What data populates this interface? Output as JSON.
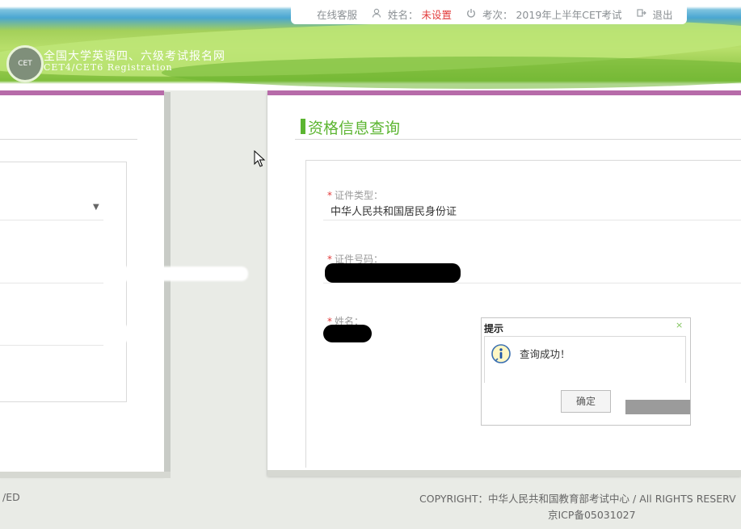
{
  "header": {
    "site_title_cn": "全国大学英语四、六级考试报名网",
    "site_title_en": "CET4/CET6  Registration",
    "logo_text": "CET",
    "nav": {
      "online_service": "在线客服",
      "name_label": "姓名：",
      "name_value": "未设置",
      "exam_label": "考次：",
      "exam_value": "2019年上半年CET考试",
      "logout": "退出"
    }
  },
  "main": {
    "section_title": "资格信息查询",
    "fields": {
      "id_type": {
        "label": "证件类型：",
        "value": "中华人民共和国居民身份证"
      },
      "id_number": {
        "label": "证件号码："
      },
      "name": {
        "label": "姓名："
      }
    }
  },
  "dialog": {
    "title": "提示",
    "close": "×",
    "message": "查询成功！",
    "ok_label": "确定"
  },
  "footer": {
    "left_fragment": "/ED",
    "copyright": "COPYRIGHT：中华人民共和国教育部考试中心 / All RIGHTS RESERV",
    "icp": "京ICP备05031027"
  },
  "colors": {
    "accent_green": "#5cb531",
    "panel_top_border": "#b76ba9",
    "warning_red": "#e23b3b"
  },
  "icons": [
    "user-icon",
    "power-icon",
    "logout-icon",
    "info-icon",
    "cursor-icon",
    "dropdown-caret-icon"
  ]
}
